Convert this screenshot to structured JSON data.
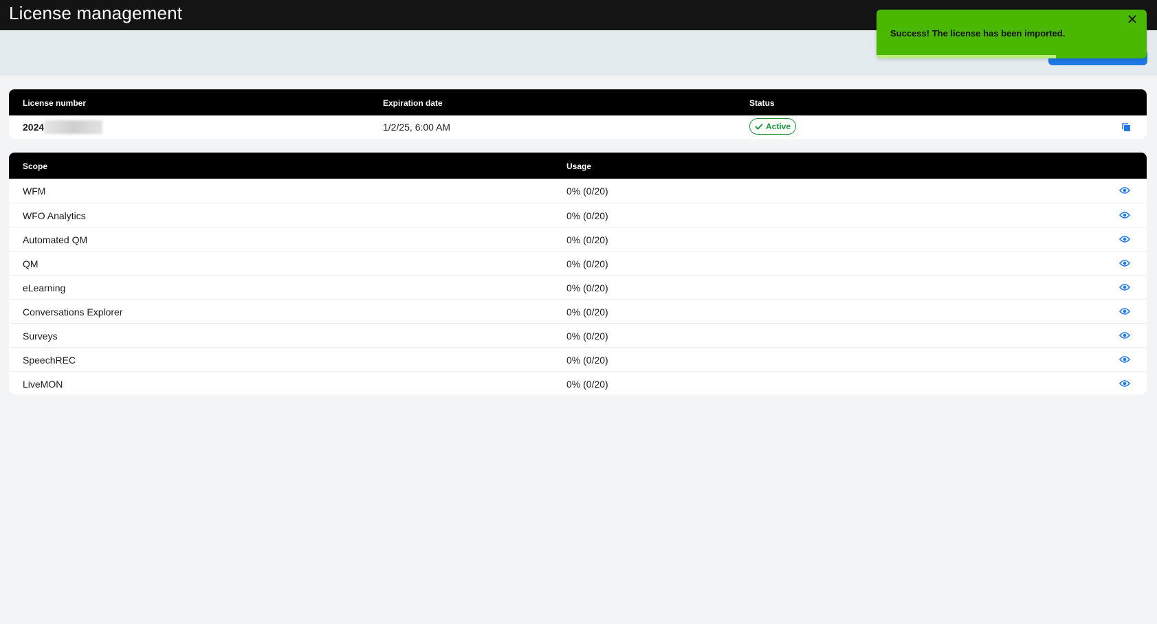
{
  "header": {
    "title": "License management"
  },
  "toast": {
    "message": "Success! The license has been imported.",
    "close_icon": "close-icon",
    "progress": 0.665
  },
  "license_table": {
    "columns": [
      "License number",
      "Expiration date",
      "Status"
    ],
    "row": {
      "license_number": "2024",
      "expiration": "1/2/25, 6:00 AM",
      "status": "Active"
    },
    "colors": {
      "active": "#1e9a3c",
      "accent": "#1e78e6"
    }
  },
  "scope_table": {
    "columns": [
      "Scope",
      "Usage"
    ],
    "rows": [
      {
        "scope": "WFM",
        "usage": "0% (0/20)"
      },
      {
        "scope": "WFO Analytics",
        "usage": "0% (0/20)"
      },
      {
        "scope": "Automated QM",
        "usage": "0% (0/20)"
      },
      {
        "scope": "QM",
        "usage": "0% (0/20)"
      },
      {
        "scope": "eLearning",
        "usage": "0% (0/20)"
      },
      {
        "scope": "Conversations Explorer",
        "usage": "0% (0/20)"
      },
      {
        "scope": "Surveys",
        "usage": "0% (0/20)"
      },
      {
        "scope": "SpeechREC",
        "usage": "0% (0/20)"
      },
      {
        "scope": "LiveMON",
        "usage": "0% (0/20)"
      }
    ]
  }
}
